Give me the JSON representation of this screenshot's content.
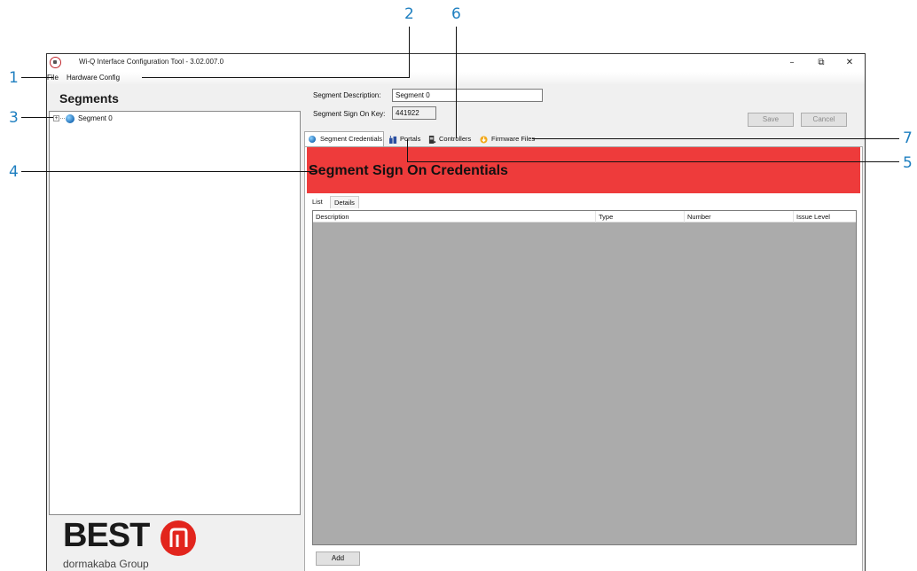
{
  "window": {
    "title": "Wi-Q Interface Configuration Tool - 3.02.007.0",
    "controls": {
      "minimize": "–",
      "restore": "⧉",
      "close": "✕"
    }
  },
  "menu": {
    "file": "File",
    "hardware_config": "Hardware Config"
  },
  "segments_panel": {
    "title": "Segments",
    "tree": [
      {
        "label": "Segment 0",
        "expander": "+",
        "icon": "globe-icon"
      }
    ]
  },
  "logo": {
    "brand": "BEST",
    "tagline": "dormakaba Group"
  },
  "form": {
    "description_label": "Segment Description:",
    "description_value": "Segment 0",
    "signon_key_label": "Segment Sign On Key:",
    "signon_key_value": "441922",
    "save": "Save",
    "cancel": "Cancel"
  },
  "tabs": [
    {
      "label": "Segment Credentials",
      "icon": "globe-icon",
      "active": true
    },
    {
      "label": "Portals",
      "icon": "building-icon"
    },
    {
      "label": "Controllers",
      "icon": "controller-icon"
    },
    {
      "label": "Firmware Files",
      "icon": "firmware-icon"
    }
  ],
  "banner": {
    "title": "Segment Sign On Credentials",
    "color": "#ee3b3b"
  },
  "subtabs": {
    "list": "List",
    "details": "Details"
  },
  "grid": {
    "columns": [
      "Description",
      "Type",
      "Number",
      "Issue Level"
    ],
    "rows": []
  },
  "add_button": "Add",
  "callouts": [
    "1",
    "2",
    "3",
    "4",
    "5",
    "6",
    "7"
  ]
}
